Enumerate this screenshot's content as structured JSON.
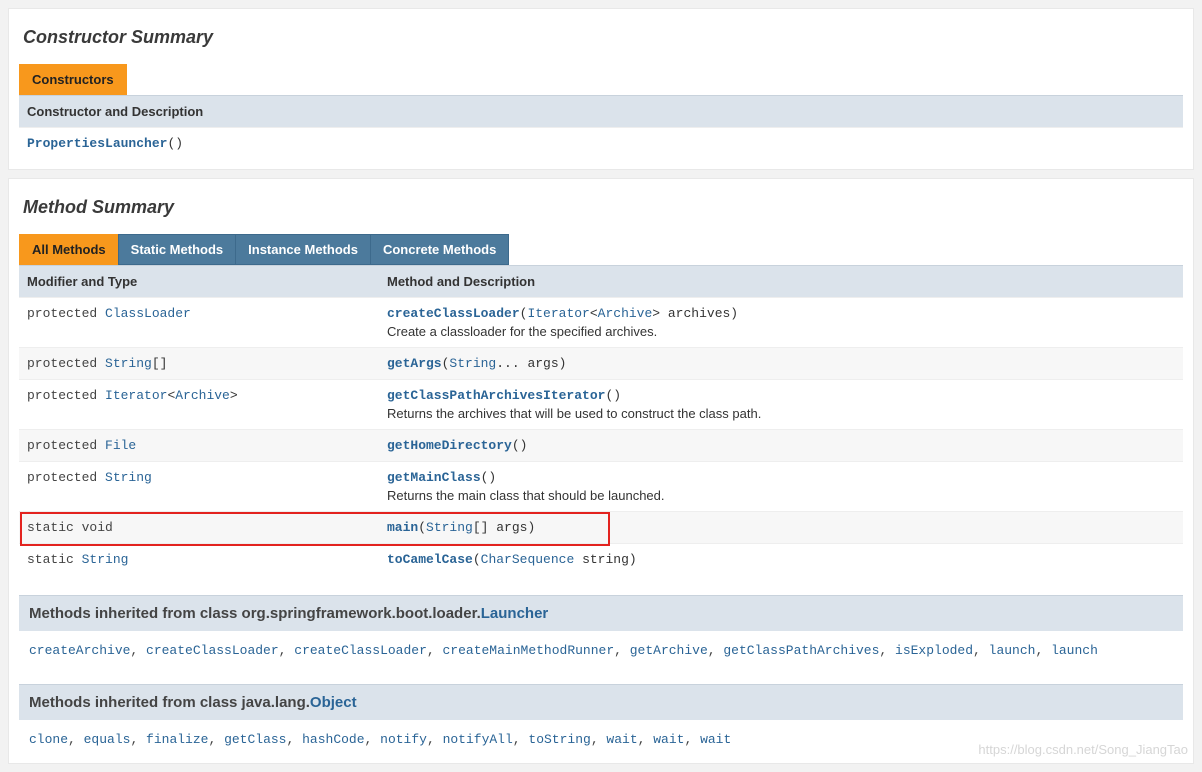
{
  "constructor_section": {
    "title": "Constructor Summary",
    "tab": "Constructors",
    "header": "Constructor and Description",
    "row": {
      "name": "PropertiesLauncher",
      "parens": "()"
    }
  },
  "method_section": {
    "title": "Method Summary",
    "tabs": [
      "All Methods",
      "Static Methods",
      "Instance Methods",
      "Concrete Methods"
    ],
    "col1": "Modifier and Type",
    "col2": "Method and Description",
    "rows": [
      {
        "mod": "protected ",
        "type": "ClassLoader",
        "suffix": "",
        "method": "createClassLoader",
        "sig_open": "(",
        "sig_parts": [
          {
            "t": "Iterator",
            "link": true
          },
          {
            "t": "<",
            "link": false
          },
          {
            "t": "Archive",
            "link": true
          },
          {
            "t": "> archives)",
            "link": false
          }
        ],
        "desc": "Create a classloader for the specified archives."
      },
      {
        "mod": "protected ",
        "type": "String",
        "suffix": "[]",
        "method": "getArgs",
        "sig_open": "(",
        "sig_parts": [
          {
            "t": "String",
            "link": true
          },
          {
            "t": "... args)",
            "link": false
          }
        ],
        "desc": ""
      },
      {
        "mod": "protected ",
        "type": "Iterator",
        "suffix": "<",
        "type2": "Archive",
        "suffix2": ">",
        "method": "getClassPathArchivesIterator",
        "sig_open": "()",
        "sig_parts": [],
        "desc": "Returns the archives that will be used to construct the class path."
      },
      {
        "mod": "protected ",
        "type": "File",
        "suffix": "",
        "method": "getHomeDirectory",
        "sig_open": "()",
        "sig_parts": [],
        "desc": ""
      },
      {
        "mod": "protected ",
        "type": "String",
        "suffix": "",
        "method": "getMainClass",
        "sig_open": "()",
        "sig_parts": [],
        "desc": "Returns the main class that should be launched."
      },
      {
        "mod": "static void",
        "type": "",
        "suffix": "",
        "method": "main",
        "sig_open": "(",
        "sig_parts": [
          {
            "t": "String",
            "link": true
          },
          {
            "t": "[] args)",
            "link": false
          }
        ],
        "desc": "",
        "highlight": true
      },
      {
        "mod": "static ",
        "type": "String",
        "suffix": "",
        "method": "toCamelCase",
        "sig_open": "(",
        "sig_parts": [
          {
            "t": "CharSequence",
            "link": true
          },
          {
            "t": " string)",
            "link": false
          }
        ],
        "desc": ""
      }
    ]
  },
  "inherited": [
    {
      "label_prefix": "Methods inherited from class org.springframework.boot.loader.",
      "cls": "Launcher",
      "methods": [
        "createArchive",
        "createClassLoader",
        "createClassLoader",
        "createMainMethodRunner",
        "getArchive",
        "getClassPathArchives",
        "isExploded",
        "launch",
        "launch"
      ]
    },
    {
      "label_prefix": "Methods inherited from class java.lang.",
      "cls": "Object",
      "methods": [
        "clone",
        "equals",
        "finalize",
        "getClass",
        "hashCode",
        "notify",
        "notifyAll",
        "toString",
        "wait",
        "wait",
        "wait"
      ]
    }
  ],
  "watermark": "https://blog.csdn.net/Song_JiangTao"
}
